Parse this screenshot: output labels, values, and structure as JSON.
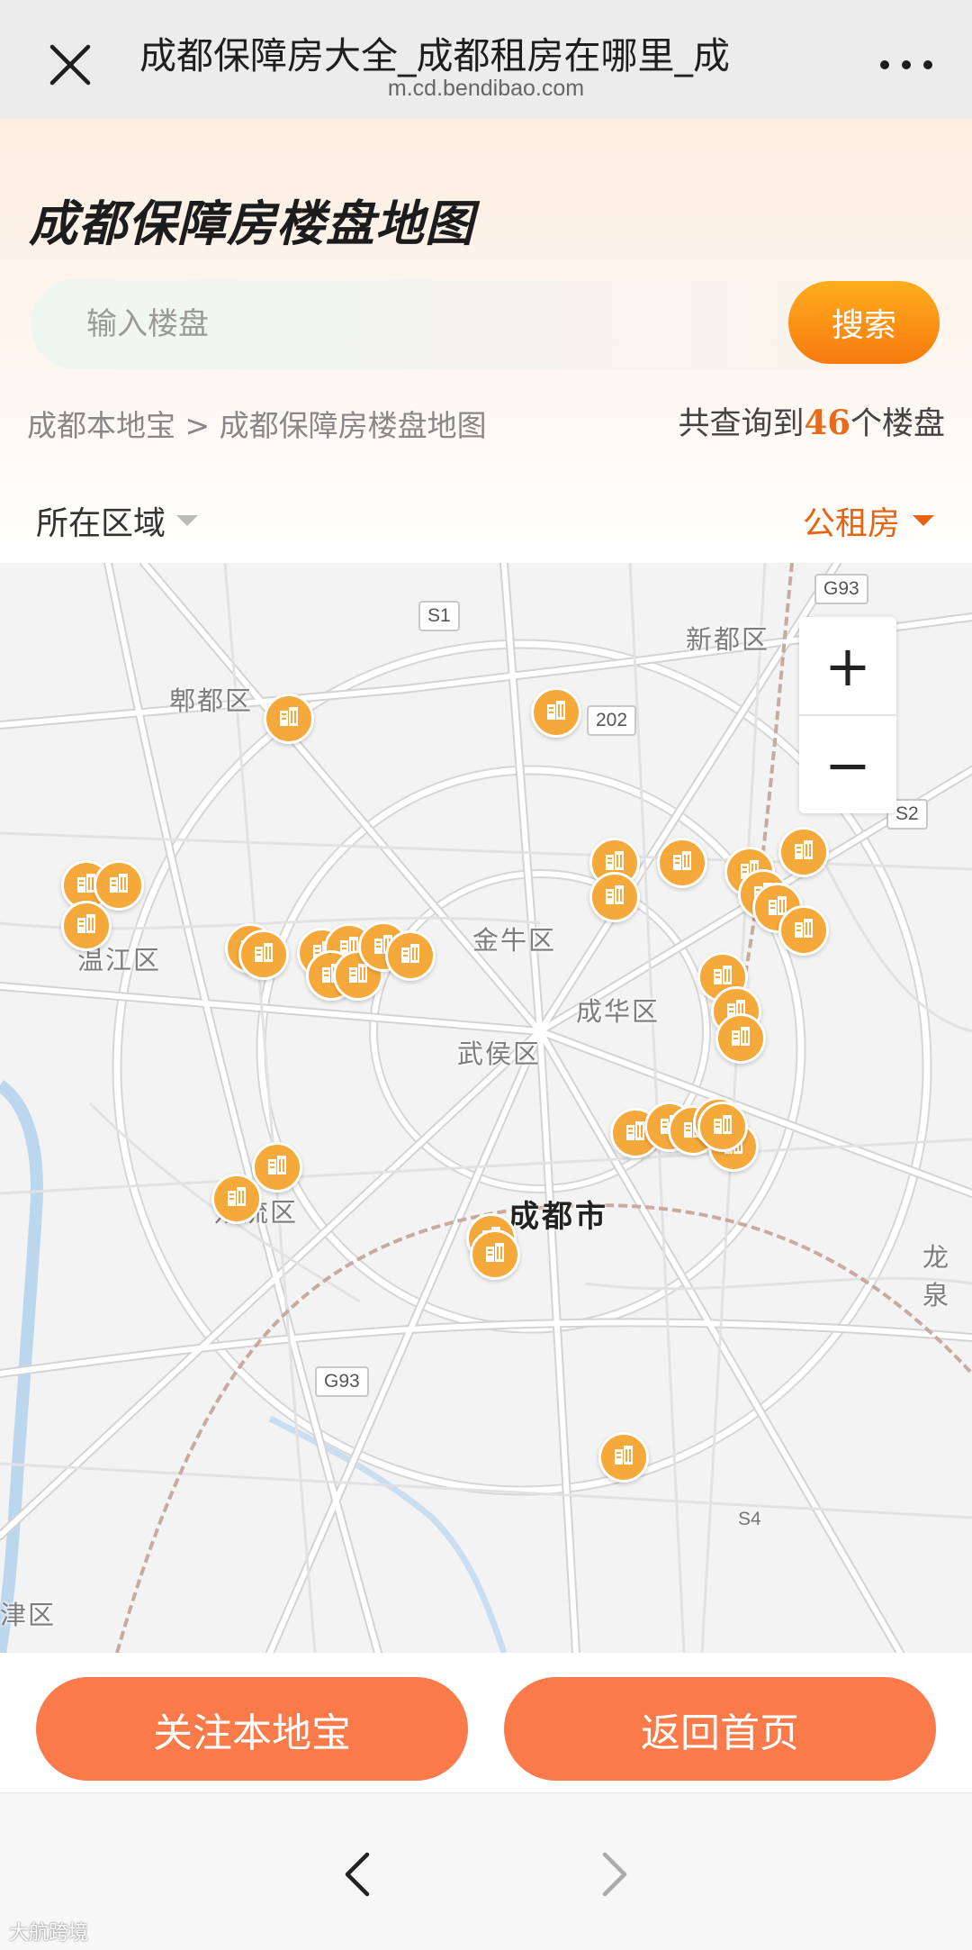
{
  "browser": {
    "title": "成都保障房大全_成都租房在哪里_成",
    "url": "m.cd.bendibao.com"
  },
  "header": {
    "heading": "成都保障房楼盘地图",
    "search_placeholder": "输入楼盘",
    "search_button": "搜索",
    "breadcrumb_home": "成都本地宝",
    "breadcrumb_sep": " > ",
    "breadcrumb_current": "成都保障房楼盘地图",
    "count_prefix": "共查询到",
    "count_value": "46",
    "count_suffix": "个楼盘"
  },
  "filters": {
    "region_label": "所在区域",
    "type_label": "公租房"
  },
  "map": {
    "districts": {
      "pidu": "郫都区",
      "xindu": "新都区",
      "wenjiang": "温江区",
      "jinniu": "金牛区",
      "chenghua": "成华区",
      "wuhou": "武侯区",
      "shuangliu": "双流区",
      "longquan": "龙泉",
      "xinjin": "津区"
    },
    "city": "成都市",
    "roads": {
      "s1": "S1",
      "g93_top": "G93",
      "r202": "202",
      "s2": "S2",
      "g93_bottom": "G93",
      "s4": "S4"
    },
    "zoom_in": "+",
    "zoom_out": "−",
    "pin_icon": "building-icon",
    "pin_color": "#f6a93b"
  },
  "actions": {
    "follow": "关注本地宝",
    "home": "返回首页"
  },
  "watermark": "大航跨境"
}
